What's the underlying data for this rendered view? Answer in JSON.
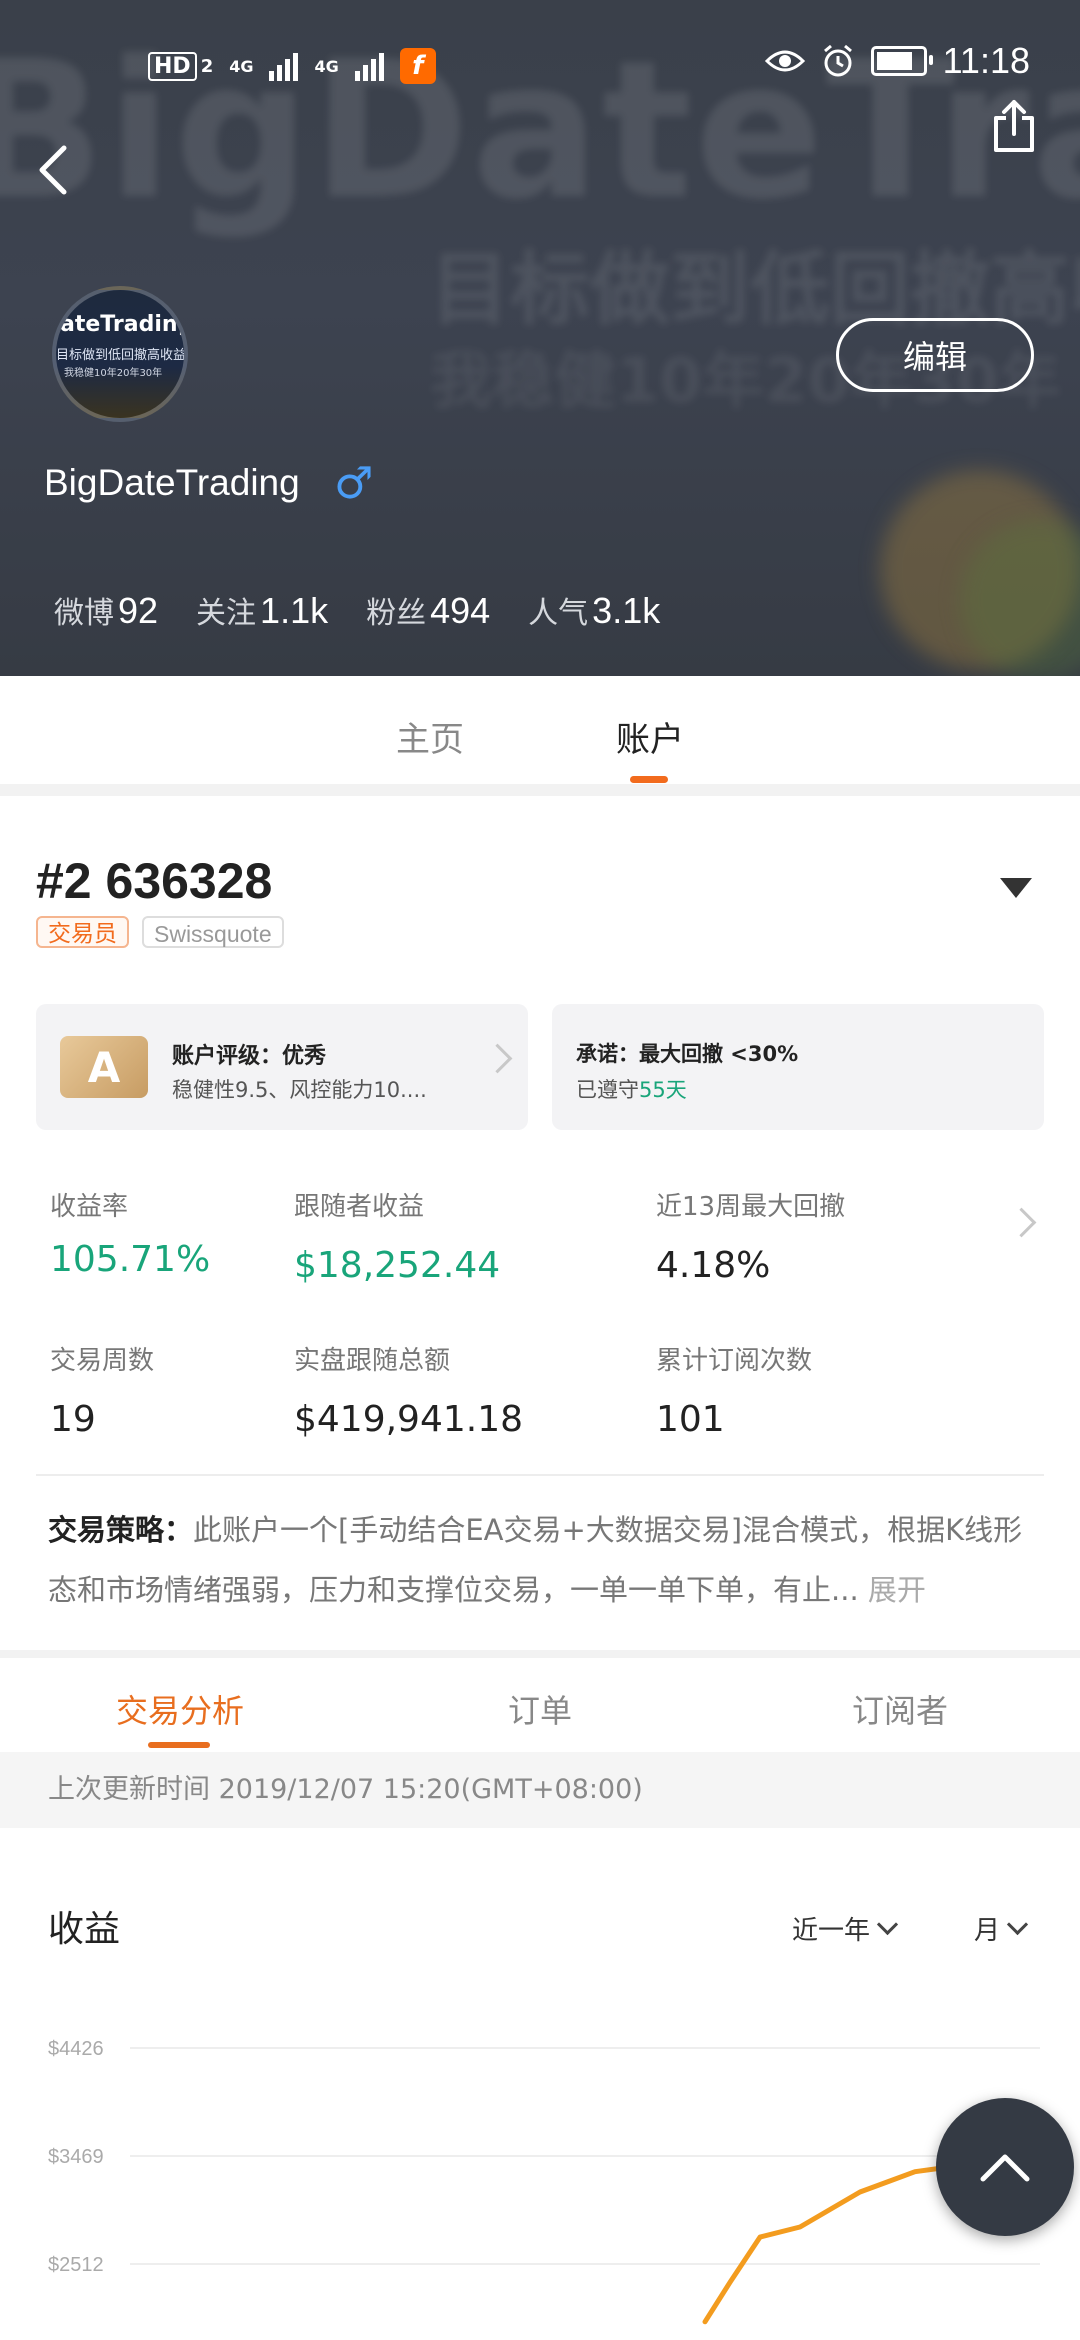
{
  "status_bar": {
    "time": "11:18",
    "hd": "HD",
    "sim": "2",
    "net1": "4G",
    "net2": "4G",
    "app_icon": "f"
  },
  "header": {
    "bg_title": "BigDateTrading",
    "username": "BigDateTrading",
    "gender_symbol": "♂",
    "edit_label": "编辑",
    "avatar_text": "ateTrading",
    "stats": [
      {
        "label": "微博",
        "value": "92"
      },
      {
        "label": "关注",
        "value": "1.1k"
      },
      {
        "label": "粉丝",
        "value": "494"
      },
      {
        "label": "人气",
        "value": "3.1k"
      }
    ]
  },
  "main_tabs": [
    {
      "label": "主页",
      "active": false
    },
    {
      "label": "账户",
      "active": true
    }
  ],
  "account": {
    "title": "#2 636328",
    "tag_role": "交易员",
    "tag_broker": "Swissquote",
    "rating_badge": "A",
    "rating_title": "账户评级：优秀",
    "rating_desc": "稳健性9.5、风控能力10....",
    "promise_title": "承诺：最大回撤 <30%",
    "promise_prefix": "已遵守",
    "promise_days": "55天",
    "metrics": {
      "yield_label": "收益率",
      "yield_value": "105.71%",
      "follower_profit_label": "跟随者收益",
      "follower_profit_value": "$18,252.44",
      "drawdown_label": "近13周最大回撤",
      "drawdown_value": "4.18%",
      "weeks_label": "交易周数",
      "weeks_value": "19",
      "follow_total_label": "实盘跟随总额",
      "follow_total_value": "$419,941.18",
      "subs_label": "累计订阅次数",
      "subs_value": "101"
    },
    "strategy_label": "交易策略：",
    "strategy_text": "此账户一个[手动结合EA交易+大数据交易]混合模式，根据K线形态和市场情绪强弱，压力和支撑位交易，一单一单下单，有止...",
    "expand_label": "展开"
  },
  "sub_tabs": [
    {
      "label": "交易分析",
      "active": true
    },
    {
      "label": "订单",
      "active": false
    },
    {
      "label": "订阅者",
      "active": false
    }
  ],
  "update_text": "上次更新时间 2019/12/07 15:20(GMT+08:00)",
  "chart_section": {
    "title": "收益",
    "range_label": "近一年",
    "period_label": "月"
  },
  "colors": {
    "accent": "#f26b1d",
    "green": "#19a57a",
    "line": "#f39c1f"
  },
  "chart_data": {
    "type": "line",
    "title": "收益",
    "y_ticks": [
      "$4426",
      "$3469",
      "$2512"
    ],
    "ylim": [
      2000,
      4426
    ],
    "series": [
      {
        "x": [
          0,
          1,
          2,
          3,
          4,
          5,
          6
        ],
        "values": [
          2000,
          2350,
          2750,
          2840,
          3150,
          3330,
          3390
        ]
      }
    ],
    "grid": true
  }
}
